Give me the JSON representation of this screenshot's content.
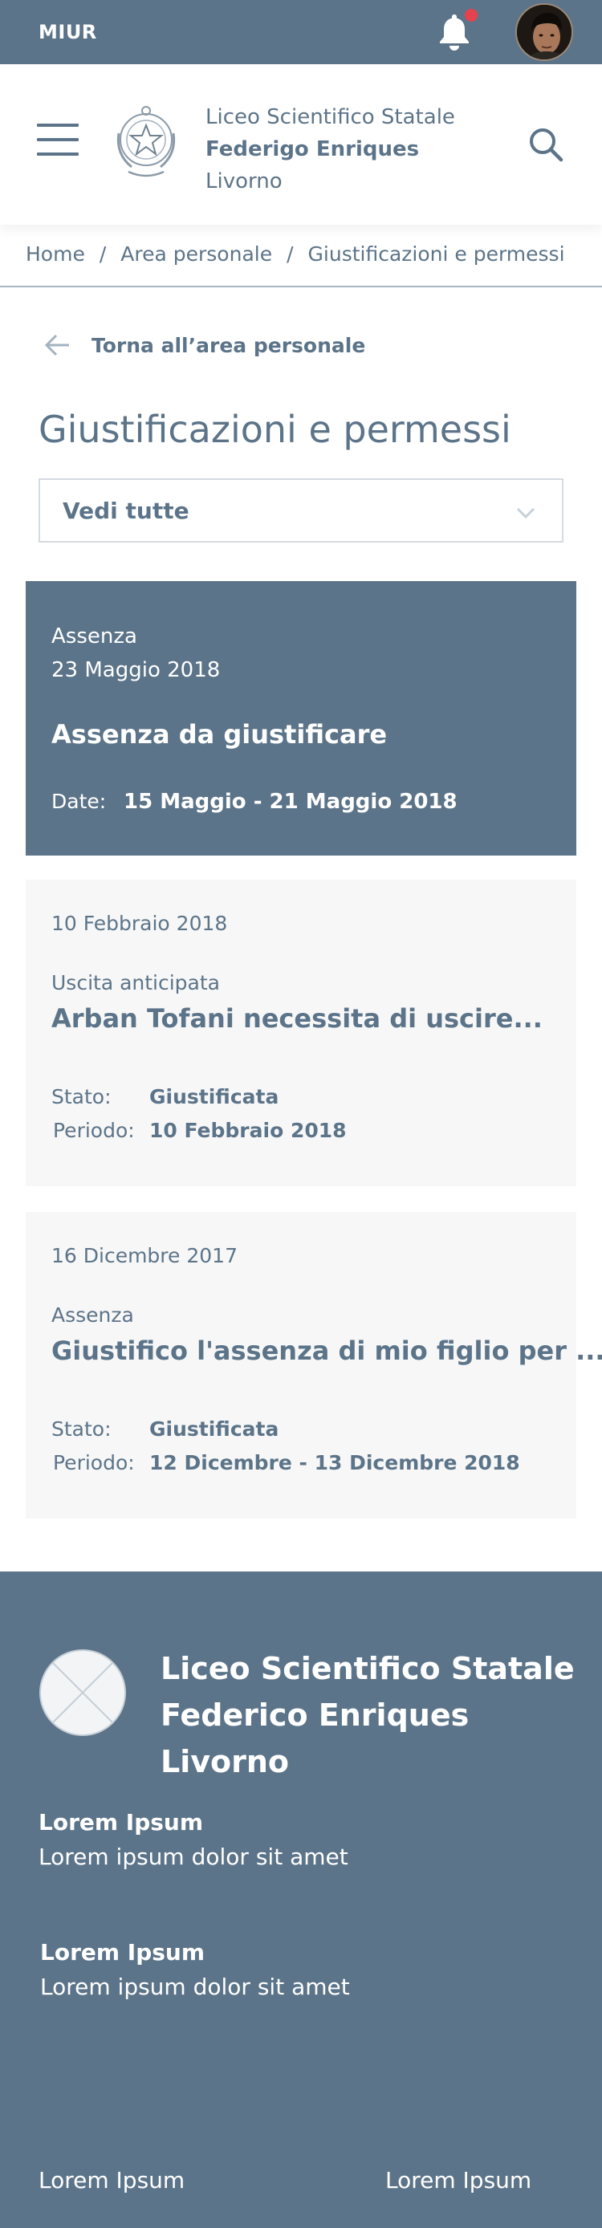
{
  "topbar": {
    "brand": "MIUR",
    "notifications_icon": "bell-icon",
    "avatar_icon": "user-avatar",
    "accent_color": "#e5424d"
  },
  "header": {
    "menu_icon": "hamburger-menu-icon",
    "emblem_icon": "italian-republic-emblem",
    "school_line1": "Liceo Scientifico Statale",
    "school_line2": "Federigo Enriques",
    "school_line3": "Livorno",
    "search_icon": "search-icon"
  },
  "breadcrumb": {
    "items": [
      "Home",
      "Area personale",
      "Giustificazioni e permessi"
    ],
    "separator": "/"
  },
  "back_link": {
    "icon": "arrow-left-icon",
    "label": "Torna all’area personale"
  },
  "page": {
    "title": "Giustificazioni e permessi"
  },
  "filter": {
    "selected": "Vedi tutte",
    "icon": "chevron-down-icon"
  },
  "cards": [
    {
      "kind": "Assenza",
      "date": "23 Maggio 2018",
      "title": "Assenza da giustificare",
      "date_label": "Date:",
      "date_value": "15 Maggio - 21 Maggio 2018"
    },
    {
      "date": "10 Febbraio 2018",
      "type": "Uscita anticipata",
      "title": "Arban Tofani necessita di uscire...",
      "stato_label": "Stato:",
      "stato_value": "Giustificata",
      "periodo_label": "Periodo:",
      "periodo_value": "10 Febbraio 2018"
    },
    {
      "date": "16 Dicembre 2017",
      "type": "Assenza",
      "title": "Giustifico l'assenza di mio figlio per ...",
      "stato_label": "Stato:",
      "stato_value": "Giustificata",
      "periodo_label": "Periodo:",
      "periodo_value": "12 Dicembre - 13 Dicembre 2018"
    }
  ],
  "footer": {
    "logo_icon": "placeholder-logo",
    "school_line1": "Liceo Scientifico Statale",
    "school_line2": "Federico Enriques",
    "school_line3": "Livorno",
    "blocks": [
      {
        "heading": "Lorem Ipsum",
        "text": "Lorem ipsum dolor sit amet"
      },
      {
        "heading": "Lorem Ipsum",
        "text": "Lorem ipsum dolor sit amet"
      }
    ],
    "links": [
      "Lorem Ipsum",
      "Lorem Ipsum"
    ]
  },
  "colors": {
    "primary": "#5c7489",
    "card_bg": "#f7f7f7",
    "notification_dot": "#e5424d"
  }
}
